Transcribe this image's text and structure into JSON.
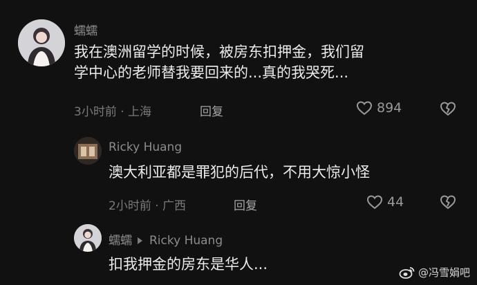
{
  "comments": [
    {
      "username": "蠕蠕",
      "text_line1": "我在澳洲留学的时候，被房东扣押金，我们留",
      "text_line2": "学中心的老师替我要回来的...真的我哭死...",
      "time_location": "3小时前 · 上海",
      "reply_label": "回复",
      "likes": "894"
    },
    {
      "username": "Ricky Huang",
      "text": "澳大利亚都是罪犯的后代，不用大惊小怪",
      "time_location": "2小时前 · 广西",
      "reply_label": "回复",
      "likes": "44"
    },
    {
      "username": "蠕蠕",
      "reply_to": "Ricky Huang",
      "text": "扣我押金的房东是华人..."
    }
  ],
  "watermark": {
    "text": "@冯雪娟吧"
  },
  "colors": {
    "background": "#111111",
    "text": "#ececec",
    "meta": "#7a7a7a"
  },
  "icons": {
    "like": "heart-outline-icon",
    "dislike": "broken-heart-icon",
    "watermark": "weibo-logo-icon"
  }
}
